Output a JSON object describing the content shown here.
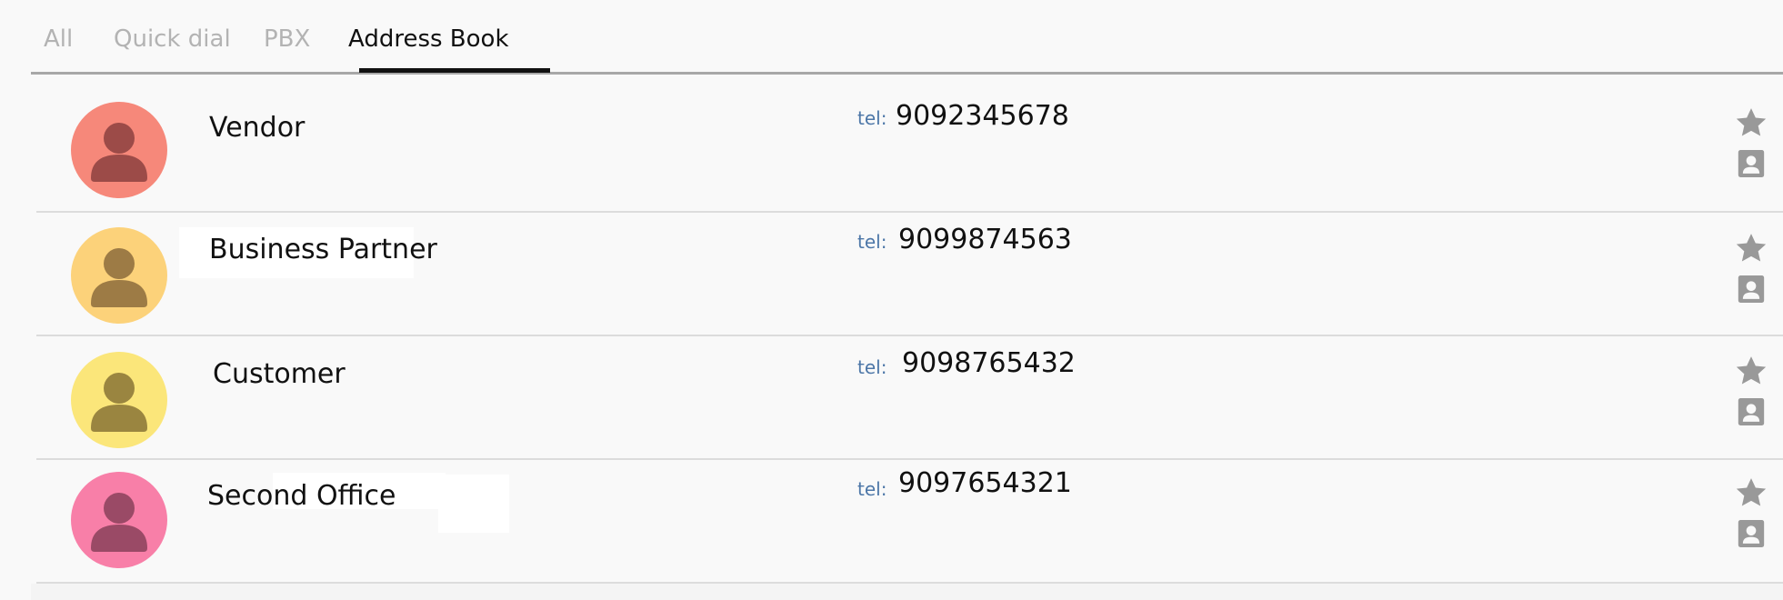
{
  "tabs": [
    {
      "label": "All",
      "active": false
    },
    {
      "label": "Quick dial",
      "active": false
    },
    {
      "label": "PBX",
      "active": false
    },
    {
      "label": "Address Book",
      "active": true
    }
  ],
  "contacts": [
    {
      "name": "Vendor",
      "tel_label": "tel:",
      "phone": "9092345678",
      "avatar_color": "#f6887a",
      "icon_color": "#9c4b48"
    },
    {
      "name": "Business Partner",
      "tel_label": "tel:",
      "phone": "9099874563",
      "avatar_color": "#fcd27a",
      "icon_color": "#9d7b45"
    },
    {
      "name": "Customer",
      "tel_label": "tel:",
      "phone": "9098765432",
      "avatar_color": "#fbe67a",
      "icon_color": "#9a8540"
    },
    {
      "name": "Second Office",
      "tel_label": "tel:",
      "phone": "9097654321",
      "avatar_color": "#f87fa8",
      "icon_color": "#9a4a66"
    }
  ],
  "icons": {
    "favorite": "star-icon",
    "contact": "contact-card-icon",
    "avatar": "person-icon"
  },
  "colors": {
    "background": "#f9f9f9",
    "tel_label": "#4d77a8",
    "action_icon": "#999999",
    "active_tab": "#111111",
    "inactive_tab": "#b3b3b3"
  }
}
